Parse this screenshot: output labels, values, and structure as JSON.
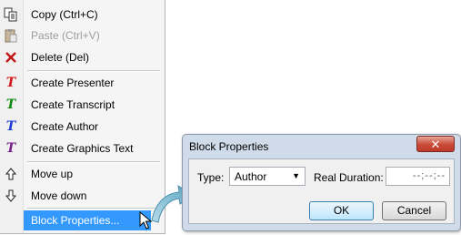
{
  "context_menu": {
    "items": [
      {
        "label": "Copy (Ctrl+C)",
        "icon": "copy-icon",
        "enabled": true
      },
      {
        "label": "Paste (Ctrl+V)",
        "icon": "paste-icon",
        "enabled": false
      },
      {
        "label": "Delete (Del)",
        "icon": "delete-icon",
        "enabled": true
      },
      {
        "label": "Create Presenter",
        "icon": "t-red-icon",
        "color": "#d01818"
      },
      {
        "label": "Create Transcript",
        "icon": "t-green-icon",
        "color": "#108a10"
      },
      {
        "label": "Create Author",
        "icon": "t-blue-icon",
        "color": "#1a3fd0"
      },
      {
        "label": "Create Graphics Text",
        "icon": "t-purple-icon",
        "color": "#7a1f8a"
      },
      {
        "label": "Move up",
        "icon": "arrow-up-icon"
      },
      {
        "label": "Move down",
        "icon": "arrow-down-icon"
      },
      {
        "label": "Block Properties...",
        "highlighted": true
      }
    ],
    "highlight_color": "#3399ff"
  },
  "dialog": {
    "title": "Block Properties",
    "close_glyph": "✕",
    "type_label": "Type:",
    "type_value": "Author",
    "duration_label": "Real Duration:",
    "duration_value": "--;--;--",
    "ok_label": "OK",
    "cancel_label": "Cancel"
  }
}
